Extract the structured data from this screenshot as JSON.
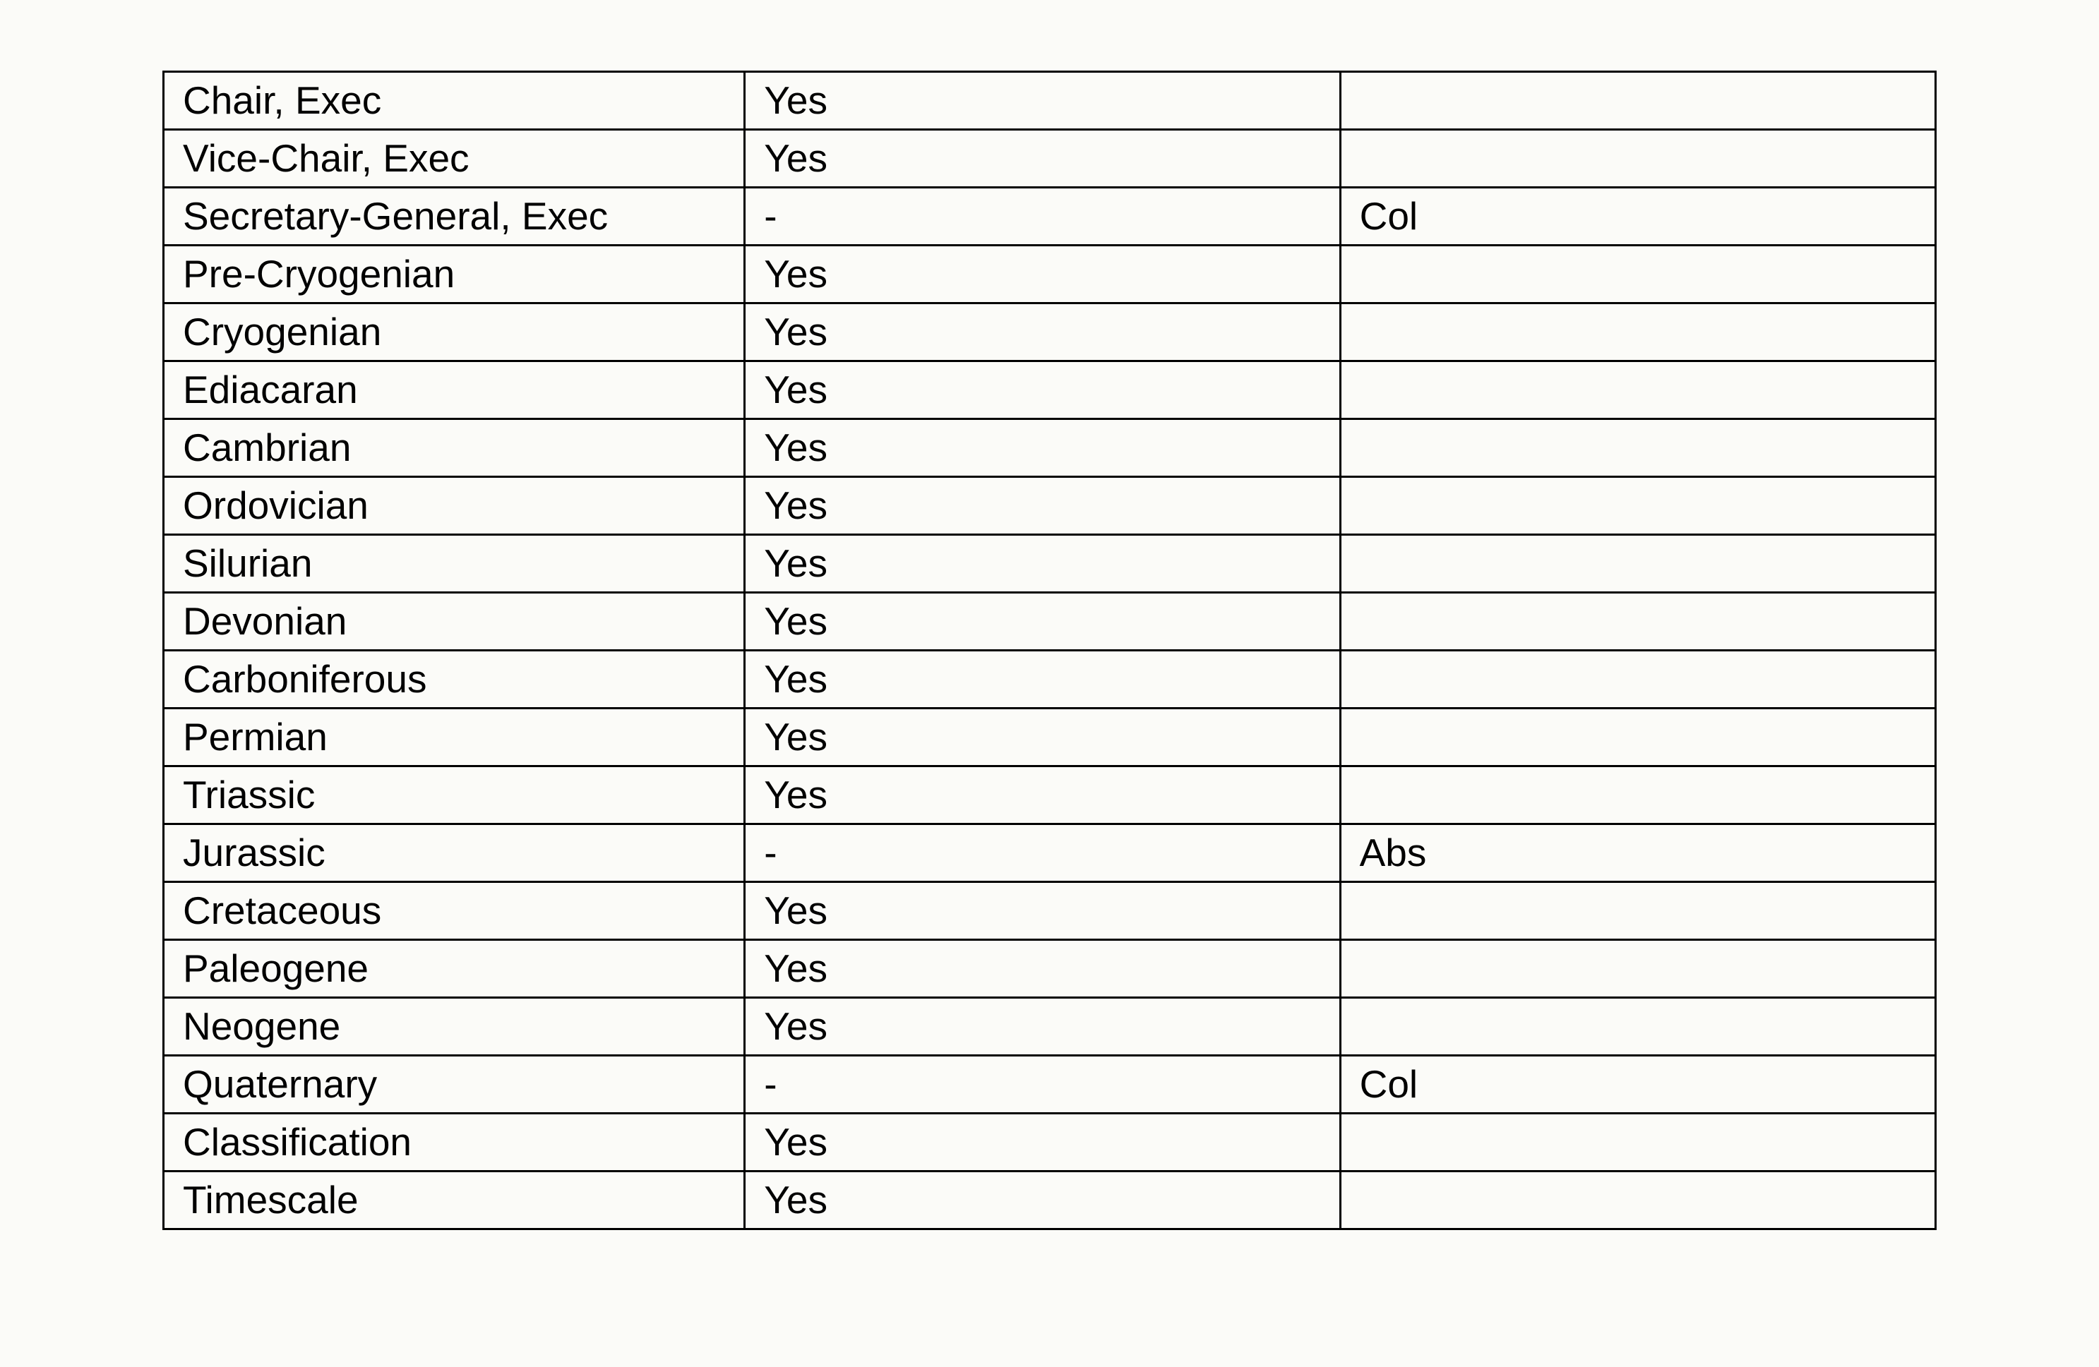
{
  "table": {
    "rows": [
      {
        "c0": "Chair, Exec",
        "c1": "Yes",
        "c2": ""
      },
      {
        "c0": "Vice-Chair, Exec",
        "c1": "Yes",
        "c2": ""
      },
      {
        "c0": "Secretary-General, Exec",
        "c1": "-",
        "c2": "Col"
      },
      {
        "c0": "Pre-Cryogenian",
        "c1": "Yes",
        "c2": ""
      },
      {
        "c0": "Cryogenian",
        "c1": "Yes",
        "c2": ""
      },
      {
        "c0": "Ediacaran",
        "c1": "Yes",
        "c2": ""
      },
      {
        "c0": "Cambrian",
        "c1": "Yes",
        "c2": ""
      },
      {
        "c0": "Ordovician",
        "c1": "Yes",
        "c2": ""
      },
      {
        "c0": "Silurian",
        "c1": "Yes",
        "c2": ""
      },
      {
        "c0": "Devonian",
        "c1": "Yes",
        "c2": ""
      },
      {
        "c0": "Carboniferous",
        "c1": "Yes",
        "c2": ""
      },
      {
        "c0": "Permian",
        "c1": "Yes",
        "c2": ""
      },
      {
        "c0": "Triassic",
        "c1": "Yes",
        "c2": ""
      },
      {
        "c0": "Jurassic",
        "c1": "-",
        "c2": "Abs"
      },
      {
        "c0": "Cretaceous",
        "c1": "Yes",
        "c2": ""
      },
      {
        "c0": "Paleogene",
        "c1": "Yes",
        "c2": ""
      },
      {
        "c0": "Neogene",
        "c1": "Yes",
        "c2": ""
      },
      {
        "c0": "Quaternary",
        "c1": "-",
        "c2": "Col"
      },
      {
        "c0": "Classification",
        "c1": "Yes",
        "c2": ""
      },
      {
        "c0": "Timescale",
        "c1": "Yes",
        "c2": ""
      }
    ]
  }
}
